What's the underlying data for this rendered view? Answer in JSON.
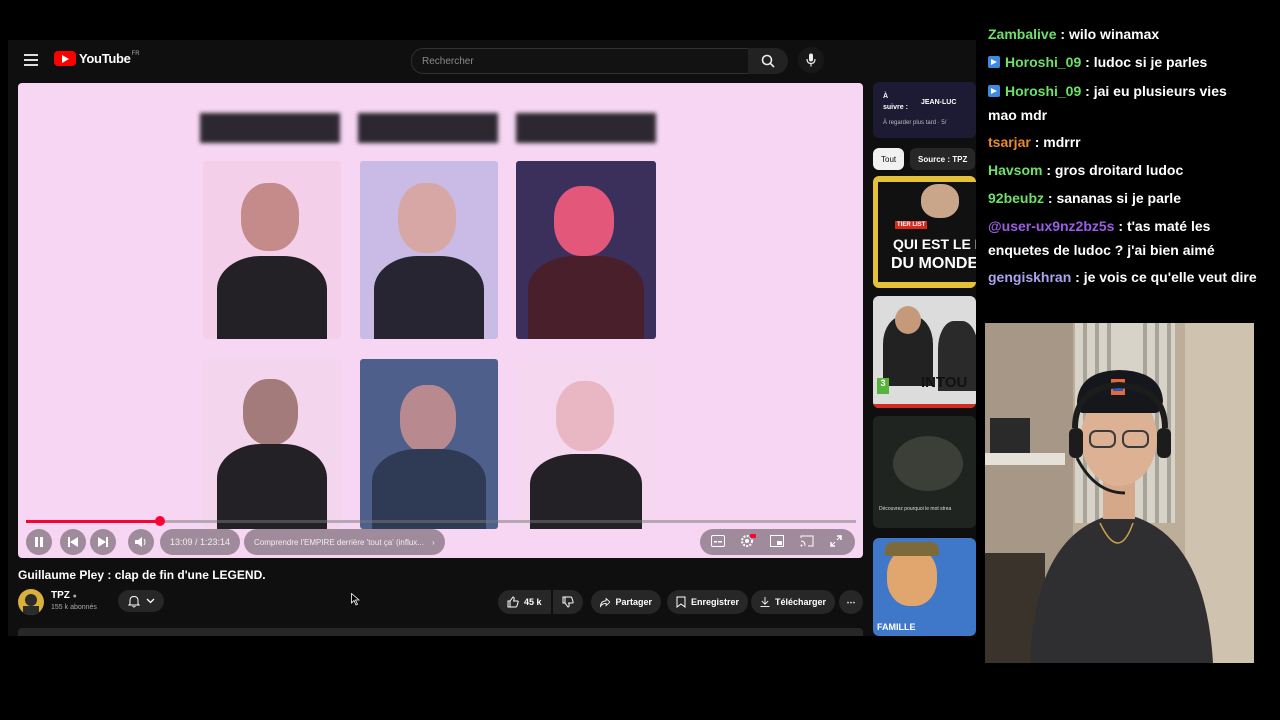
{
  "youtube": {
    "logo": "YouTube",
    "logo_country": "FR",
    "search": {
      "placeholder": "Rechercher"
    },
    "player": {
      "progress": 0.162,
      "time": "13:09 / 1:23:14",
      "chapter": "Comprendre l'EMPIRE derrière 'tout ça' (influx..."
    },
    "video": {
      "title": "Guillaume Pley : clap de fin d'une LEGEND.",
      "channel": "TPZ",
      "subscribers": "155 k abonnés",
      "likes": "45 k",
      "share_label": "Partager",
      "save_label": "Enregistrer",
      "download_label": "Télécharger"
    },
    "sidebar": {
      "promo_line1": "À",
      "promo_line2": "suivre :",
      "promo_title": "JEAN-LUC",
      "promo_sub": "À regarder plus tard · 5/",
      "chips": [
        "Tout",
        "Source : TPZ"
      ],
      "thumb1_tag": "TIER LIST",
      "thumb1_text1": "QUI EST LE M",
      "thumb1_text2": "DU MONDE",
      "thumb2_badge": "3",
      "thumb2_text": "INTOU",
      "thumb3_text": "Découvrez pourquoi le mot strea",
      "thumb4_text": "FAMILLE"
    }
  },
  "chat": {
    "messages": [
      {
        "user": "Zambalive",
        "color": "#6ee06a",
        "badge": false,
        "text": "wilo winamax"
      },
      {
        "user": "Horoshi_09",
        "color": "#6ee06a",
        "badge": true,
        "text": "ludoc si je parles"
      },
      {
        "user": "Horoshi_09",
        "color": "#6ee06a",
        "badge": true,
        "text": "jai eu plusieurs vies mao mdr"
      },
      {
        "user": "tsarjar",
        "color": "#e8892b",
        "badge": false,
        "text": "mdrrr"
      },
      {
        "user": "Havsom",
        "color": "#6ee06a",
        "badge": false,
        "text": "gros droitard ludoc"
      },
      {
        "user": "92beubz",
        "color": "#6ee06a",
        "badge": false,
        "text": "sananas si je parle"
      },
      {
        "user": "@user-ux9nz2bz5s",
        "color": "#9b5de5",
        "badge": false,
        "text": "t'as maté les enquetes de ludoc ? j'ai bien aimé"
      },
      {
        "user": "gengiskhran",
        "color": "#a9a3f0",
        "badge": false,
        "text": "je vois ce qu'elle veut dire"
      }
    ]
  }
}
